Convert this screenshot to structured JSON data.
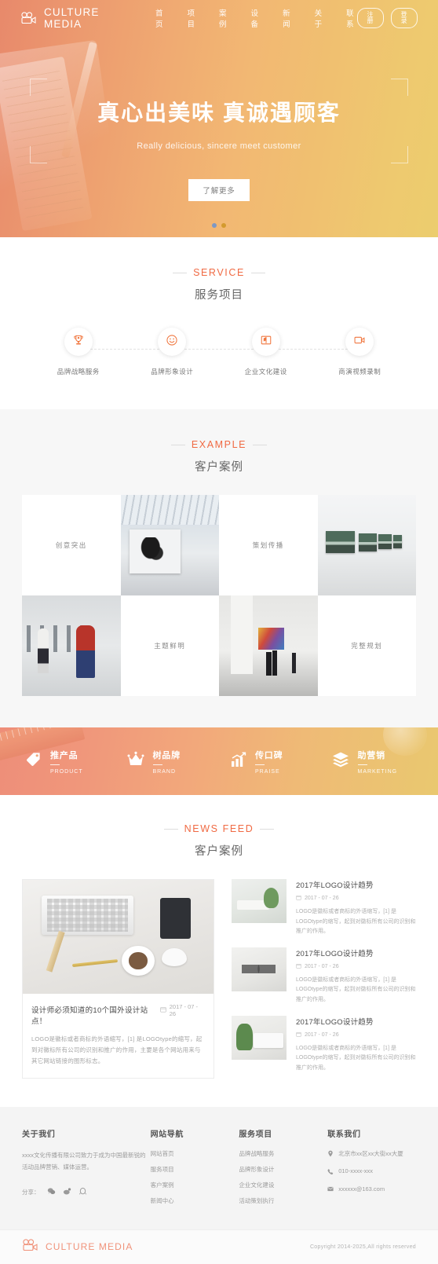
{
  "header": {
    "brand": "CULTURE MEDIA",
    "brand_icon": "video-camera-icon",
    "nav": [
      {
        "label": "首页",
        "name": "nav-home"
      },
      {
        "label": "项目",
        "name": "nav-projects"
      },
      {
        "label": "案例",
        "name": "nav-cases"
      },
      {
        "label": "设备",
        "name": "nav-equipment"
      },
      {
        "label": "新闻",
        "name": "nav-news"
      },
      {
        "label": "关于",
        "name": "nav-about"
      },
      {
        "label": "联系",
        "name": "nav-contact"
      }
    ],
    "register_label": "注册",
    "login_label": "登录"
  },
  "hero": {
    "title": "真心出美味  真诚遇顾客",
    "subtitle": "Really delicious, sincere meet customer",
    "button_label": "了解更多",
    "dots": [
      "active",
      "inactive"
    ]
  },
  "service": {
    "en": "SERVICE",
    "cn": "服务项目",
    "items": [
      {
        "label": "品牌战略服务",
        "icon": "trophy-icon"
      },
      {
        "label": "品牌形象设计",
        "icon": "smiley-icon"
      },
      {
        "label": "企业文化建设",
        "icon": "book-icon"
      },
      {
        "label": "商演视频录制",
        "icon": "video-icon"
      }
    ]
  },
  "example": {
    "en": "EXAMPLE",
    "cn": "客户案例",
    "cells": [
      {
        "type": "text",
        "label": "创意突出"
      },
      {
        "type": "photo",
        "photo": "gallery-portrait-exhibition"
      },
      {
        "type": "text",
        "label": "策划传播"
      },
      {
        "type": "photo",
        "photo": "gallery-seascape-wall"
      },
      {
        "type": "photo",
        "photo": "gallery-visitor-red-coat"
      },
      {
        "type": "text",
        "label": "主题鲜明"
      },
      {
        "type": "photo",
        "photo": "gallery-colorful-painting-visitors"
      },
      {
        "type": "text",
        "label": "完整规划"
      }
    ]
  },
  "features": [
    {
      "cn": "推产品",
      "en": "PRODUCT",
      "icon": "tag-icon"
    },
    {
      "cn": "树品牌",
      "en": "BRAND",
      "icon": "crown-icon"
    },
    {
      "cn": "传口碑",
      "en": "PRAISE",
      "icon": "bar-chart-up-icon"
    },
    {
      "cn": "助营销",
      "en": "MARKETING",
      "icon": "layers-icon"
    }
  ],
  "news": {
    "en": "NEWS FEED",
    "cn": "客户案例",
    "featured": {
      "image": "desk-keyboard-phone-coffee",
      "title": "设计师必须知道的10个国外设计站点！",
      "date": "2017 - 07 - 26",
      "desc": "LOGO是徽标或者商标的外语缩写，[1] 是LOGOtype的缩写，起到对徽标所有公司的识别和推广的作用，主要是各个网站用来与其它网站链接的图形标志。"
    },
    "items": [
      {
        "thumb": "desk-plant-charger",
        "title": "2017年LOGO设计趋势",
        "date": "2017 - 07 - 26",
        "desc": "LOGO是徽标或者商标的外语缩写，[1] 是LOGOtype的缩写，起到对徽标所有公司的识别和推广的作用。"
      },
      {
        "thumb": "desk-glasses-tray",
        "title": "2017年LOGO设计趋势",
        "date": "2017 - 07 - 26",
        "desc": "LOGO是徽标或者商标的外语缩写，[1] 是LOGOtype的缩写，起到对徽标所有公司的识别和推广的作用。"
      },
      {
        "thumb": "desk-plant-keyboard",
        "title": "2017年LOGO设计趋势",
        "date": "2017 - 07 - 26",
        "desc": "LOGO是徽标或者商标的外语缩写，[1] 是LOGOtype的缩写，起到对徽标所有公司的识别和推广的作用。"
      }
    ]
  },
  "footer": {
    "about": {
      "title": "关于我们",
      "text": "xxxx文化传播有限公司致力于成为中国最新锐的活动品牌营销、媒体运营。",
      "share_label": "分享：",
      "share_icons": [
        "weixin-icon",
        "weibo-icon",
        "qq-icon"
      ]
    },
    "nav": {
      "title": "网站导航",
      "links": [
        "网站首页",
        "服务项目",
        "客户案例",
        "新闻中心"
      ]
    },
    "service": {
      "title": "服务项目",
      "links": [
        "品牌战略服务",
        "品牌形象设计",
        "企业文化建设",
        "活动策划执行"
      ]
    },
    "contact": {
      "title": "联系我们",
      "items": [
        {
          "icon": "location-pin-icon",
          "text": "北京市xx区xx大街xx大厦"
        },
        {
          "icon": "phone-icon",
          "text": "010-xxxx-xxx"
        },
        {
          "icon": "mail-icon",
          "text": "xxxxxx@163.com"
        }
      ]
    }
  },
  "copyright": {
    "brand": "CULTURE MEDIA",
    "text": "Copyright  2014-2025,All rights reserved"
  },
  "colors": {
    "accent": "#f06a43",
    "brand_soft": "#f0927a",
    "hero_start": "#e8896b",
    "hero_end": "#eccd6e"
  }
}
